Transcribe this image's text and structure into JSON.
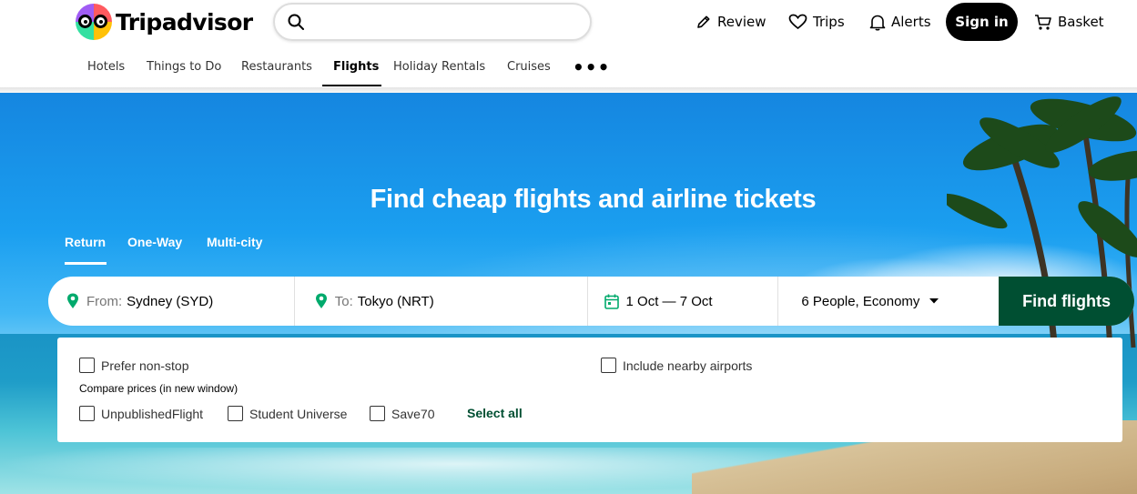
{
  "brand": {
    "name": "Tripadvisor"
  },
  "search": {
    "placeholder": "",
    "value": ""
  },
  "header_nav": {
    "review": "Review",
    "trips": "Trips",
    "alerts": "Alerts",
    "sign_in": "Sign in",
    "basket": "Basket"
  },
  "tabs": [
    {
      "label": "Hotels"
    },
    {
      "label": "Things to Do"
    },
    {
      "label": "Restaurants"
    },
    {
      "label": "Flights",
      "active": true
    },
    {
      "label": "Holiday Rentals"
    },
    {
      "label": "Cruises"
    }
  ],
  "more_tabs_glyph": "•••",
  "hero": {
    "title": "Find cheap flights and airline tickets",
    "trip_types": [
      {
        "label": "Return",
        "active": true
      },
      {
        "label": "One-Way"
      },
      {
        "label": "Multi-city"
      }
    ]
  },
  "flight_search": {
    "from_label": "From:",
    "from_value": "Sydney (SYD)",
    "to_label": "To:",
    "to_value": "Tokyo (NRT)",
    "dates": "1 Oct — 7 Oct",
    "travellers": "6 People, Economy",
    "submit": "Find flights"
  },
  "options": {
    "prefer_nonstop": "Prefer non-stop",
    "nearby_airports": "Include nearby airports",
    "compare_label": "Compare prices (in new window)",
    "providers": [
      "UnpublishedFlight",
      "Student Universe",
      "Save70"
    ],
    "select_all": "Select all"
  },
  "colors": {
    "brand_green": "#004f32",
    "pin_green": "#00aa6c",
    "sign_in_bg": "#000000"
  },
  "icons": {
    "search": "search-icon",
    "review": "pencil-icon",
    "trips": "heart-icon",
    "alerts": "bell-icon",
    "basket": "cart-icon",
    "location": "map-pin-icon",
    "calendar": "calendar-icon",
    "dropdown": "caret-down-icon"
  }
}
